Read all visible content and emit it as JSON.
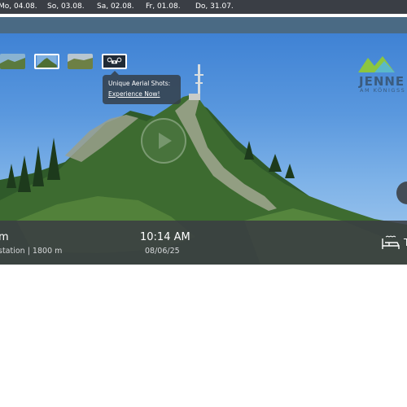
{
  "date_tabs": [
    "Mo, 04.08.",
    "So, 03.08.",
    "Sa, 02.08.",
    "Fr, 01.08.",
    "Do, 31.07."
  ],
  "tooltip": {
    "line1": "Unique Aerial Shots:",
    "link": "Experience Now!"
  },
  "brand": {
    "name": "JENNE",
    "sub": "AM KÖNIGSS"
  },
  "info": {
    "loc_suffix": "m",
    "station": "station | 1800 m",
    "time": "10:14 AM",
    "date": "08/06/25",
    "trail": "T"
  },
  "colors": {
    "bar": "#3a3e45",
    "sky": "#5a98de",
    "brand_green": "#8cc63f",
    "brand_blue": "#3a5b7e"
  },
  "icons": [
    "play-icon",
    "bed-icon",
    "drone-icon"
  ]
}
